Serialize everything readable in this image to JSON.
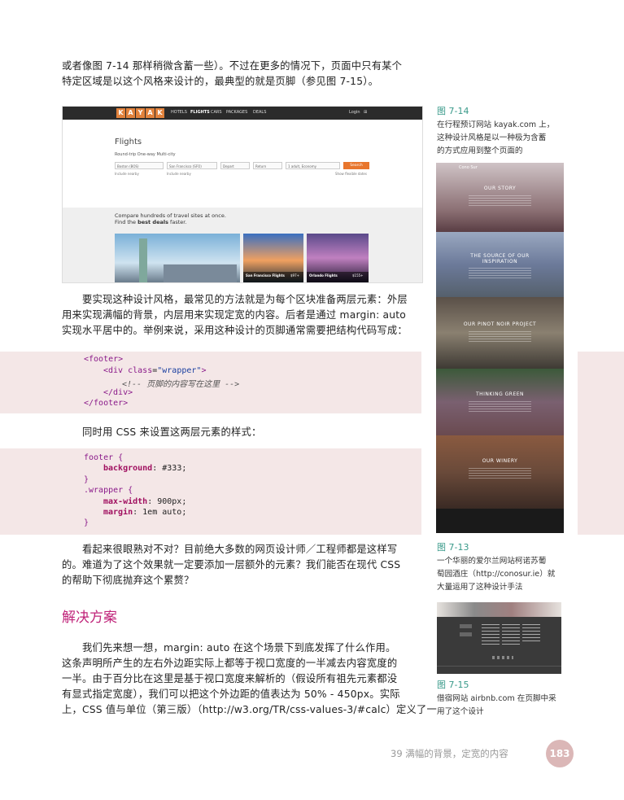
{
  "body": {
    "para1": [
      "或者像图 7-14 那样稍微含蓄一些）。不过在更多的情况下，页面中只有某个",
      "特定区域是以这个风格来设计的，最典型的就是页脚（参见图 7-15）。"
    ],
    "para2": [
      "要实现这种设计风格，最常见的方法就是为每个区块准备两层元素：外层",
      "用来实现满幅的背景，内层用来实现定宽的内容。后者是通过 margin:  auto",
      "实现水平居中的。举例来说，采用这种设计的页脚通常需要把结构代码写成："
    ],
    "para3": "同时用 CSS 来设置这两层元素的样式：",
    "para4": [
      "看起来很眼熟对不对？目前绝大多数的网页设计师／工程师都是这样写",
      "的。难道为了这个效果就一定要添加一层额外的元素？我们能否在现代 CSS",
      "的帮助下彻底抛弃这个累赘？"
    ],
    "heading": "解决方案",
    "para5": [
      "我们先来想一想，margin:  auto 在这个场景下到底发挥了什么作用。",
      "这条声明所产生的左右外边距实际上都等于视口宽度的一半减去内容宽度的",
      "一半。由于百分比在这里是基于视口宽度来解析的（假设所有祖先元素都没",
      "有显式指定宽度），我们可以把这个外边距的值表达为 50%  -  450px。实际",
      "上，CSS 值与单位（第三版）（http://w3.org/TR/css-values-3/#calc）定义了一"
    ]
  },
  "code1": {
    "l1": "<footer>",
    "l2a": "<div ",
    "l2b": "class",
    "l2c": "=",
    "l2d": "\"wrapper\"",
    "l2e": ">",
    "l3": "<!-- 页脚的内容写在这里 -->",
    "l4": "</div>",
    "l5": "</footer>"
  },
  "code2": {
    "l1": "footer {",
    "l2a": "background",
    "l2b": ": #333;",
    "l3": "}",
    "l4": ".wrapper {",
    "l5a": "max-width",
    "l5b": ": 900px;",
    "l6a": "margin",
    "l6b": ": 1em auto;",
    "l7": "}"
  },
  "figures": {
    "f14_label": "图 7-14",
    "f14_caption": [
      "在行程预订网站 kayak.com 上，",
      "这种设计风格是以一种极为含蓄",
      "的方式应用到整个页面的"
    ],
    "f13_label": "图 7-13",
    "f13_caption": [
      "一个华丽的爱尔兰网站柯诺苏葡",
      "萄园酒庄（http://conosur.ie）就",
      "大量运用了这种设计手法"
    ],
    "f15_label": "图 7-15",
    "f15_caption": [
      "借宿网站 airbnb.com 在页脚中采",
      "用了这个设计"
    ]
  },
  "kayak": {
    "logo": [
      "K",
      "A",
      "Y",
      "A",
      "K"
    ],
    "nav": [
      "HOTELS",
      "FLIGHTS",
      "CARS",
      "PACKAGES",
      "DEALS"
    ],
    "login": "Login",
    "title": "Flights",
    "tabs": "Round-trip   One-way   Multi-city",
    "from": "Boston (BOS)",
    "to": "San Francisco (SFO)",
    "depart": "Depart",
    "return": "Return",
    "travelers": "1 adult, Economy",
    "search": "Search",
    "include1": "Include nearby",
    "include2": "Include nearby",
    "flexible": "Show flexible dates",
    "compare1": "Compare hundreds of travel sites at once.",
    "compare2a": "Find the ",
    "compare2b": "best deals",
    "compare2c": " faster.",
    "cap1": "San Francisco Flights",
    "cap1p": "$97+",
    "cap2": "Orlando Flights",
    "cap2p": "$155+"
  },
  "conosur": {
    "s1": "OUR STORY",
    "s2a": "THE SOURCE OF OUR",
    "s2b": "INSPIRATION",
    "s3": "OUR PINOT NOIR PROJECT",
    "s4": "THINKING GREEN",
    "s5": "OUR WINERY"
  },
  "footer": {
    "running": "39   满幅的背景，定宽的内容",
    "page": "183"
  }
}
